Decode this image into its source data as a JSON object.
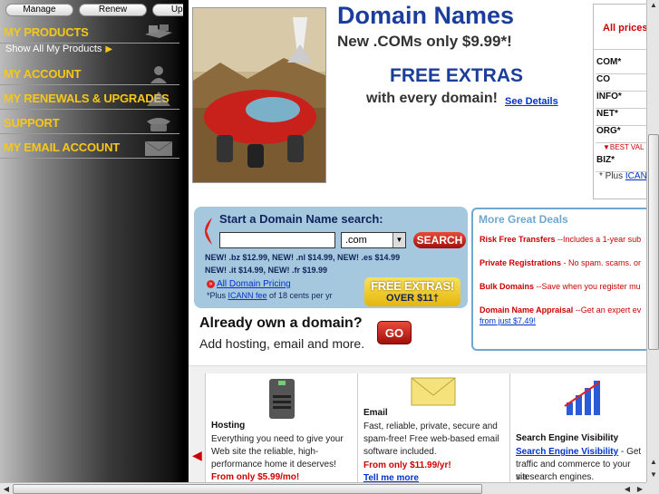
{
  "sidebar": {
    "top_buttons": [
      "Manage",
      "Renew",
      "Upgrade"
    ],
    "items": [
      {
        "label": "MY PRODUCTS",
        "icon": "boxes-icon"
      },
      {
        "label": "MY ACCOUNT",
        "icon": "person-icon"
      },
      {
        "label": "MY RENEWALS & UPGRADES",
        "icon": "arrow-up-icon"
      },
      {
        "label": "SUPPORT",
        "icon": "phone-icon"
      },
      {
        "label": "MY EMAIL ACCOUNT",
        "icon": "envelope-icon"
      }
    ],
    "show_all": "Show All My Products"
  },
  "hero": {
    "title": "Domain Names",
    "subtitle": "New .COMs only $9.99*!",
    "free_extras": "FREE EXTRAS",
    "every_domain": "with every domain!",
    "see_details": "See Details"
  },
  "search": {
    "title": "Start a Domain Name search:",
    "input_value": "",
    "tld_selected": ".com",
    "button": "SEARCH",
    "promo_line1": "NEW! .bz $12.99, NEW! .nl $14.99, NEW! .es $14.99",
    "promo_line2": "NEW! .it $14.99, NEW! .fr $19.99",
    "all_pricing": "All Domain Pricing",
    "icann_prefix": "*Plus ",
    "icann_link": "ICANN fee",
    "icann_suffix": " of 18 cents per yr",
    "badge_line1": "FREE EXTRAS!",
    "badge_line2": "OVER $11†"
  },
  "own_domain": {
    "title": "Already own a domain?",
    "subtitle": "Add hosting, email and more.",
    "button": "GO"
  },
  "deals": {
    "title": "More Great Deals",
    "items": [
      {
        "name": "Risk Free Transfers",
        "desc": " --Includes a 1-year sub"
      },
      {
        "name": "Private Registrations",
        "desc": " - No spam. scams. or"
      },
      {
        "name": "Bulk Domains",
        "desc": " --Save when you register mu"
      },
      {
        "name": "Domain Name Appraisal",
        "desc": " --Get an expert ev"
      }
    ],
    "price_link": "from just $7.49!"
  },
  "prices": {
    "header": "All prices",
    "tlds": [
      "COM*",
      "CO",
      "INFO*",
      "NET*",
      "ORG*",
      "BIZ*"
    ],
    "best_value": "BEST VAL",
    "plus_prefix": "* Plus ",
    "plus_link": "ICAN"
  },
  "products": [
    {
      "title": "Hosting",
      "desc": [
        "Everything you need to give your",
        "Web site the reliable, high-",
        "performance home it deserves!"
      ],
      "price": "From only $5.99/mo!",
      "icon": "server-icon"
    },
    {
      "title": "Email",
      "desc": [
        "Fast, reliable, private, secure and",
        "spam-free! Free web-based email",
        "software included."
      ],
      "price": "From only $11.99/yr!",
      "link": "Tell me more",
      "icon": "envelope-icon"
    },
    {
      "title": "Search Engine Visibility",
      "link": "Search Engine Visibility",
      "desc": [
        " - Get",
        "traffic and commerce to your site",
        "via search engines."
      ],
      "icon": "bar-chart-icon"
    }
  ],
  "colors": {
    "brand_blue": "#1b3d9c",
    "accent_yellow": "#f5c71a",
    "alert_red": "#c00000",
    "search_panel": "#a5c8df"
  }
}
